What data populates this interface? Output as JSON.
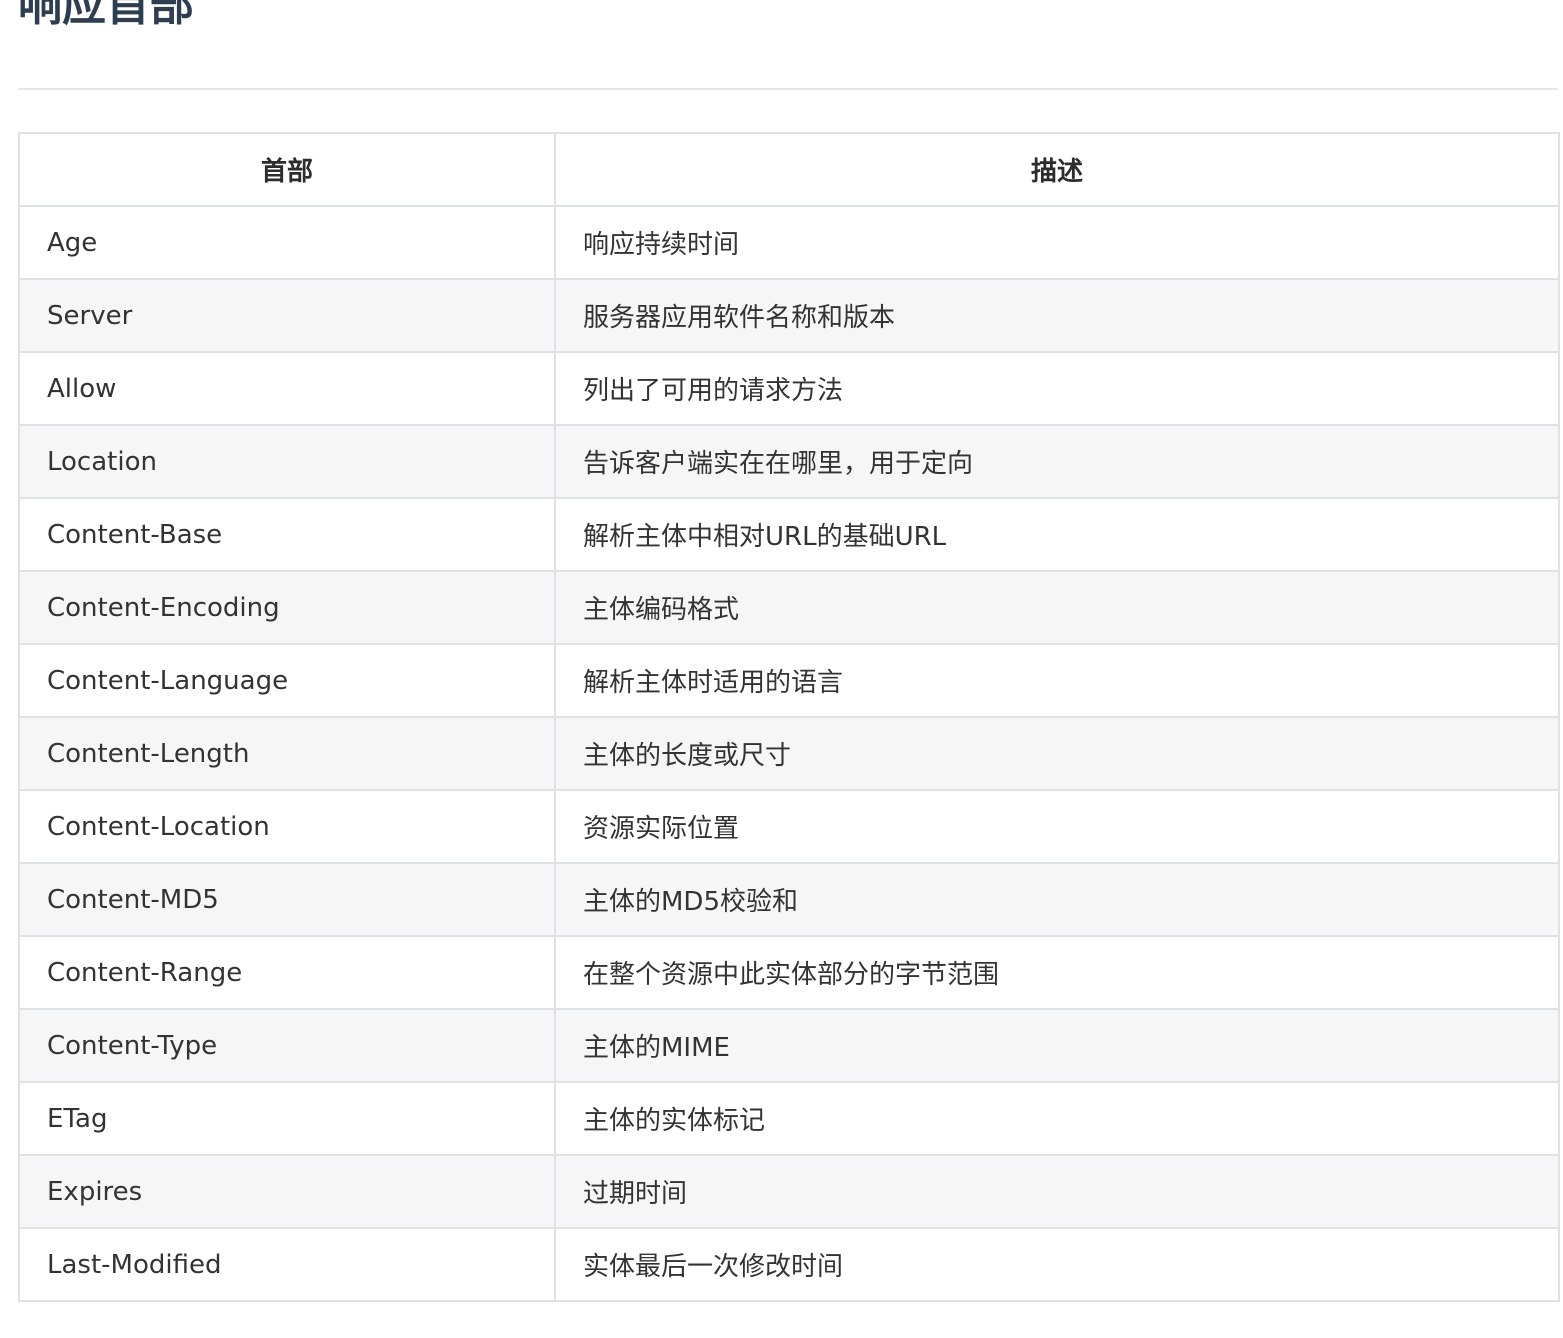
{
  "page": {
    "heading": "响应首部"
  },
  "table": {
    "columns": [
      "首部",
      "描述"
    ],
    "rows": [
      {
        "header": "Age",
        "description": "响应持续时间"
      },
      {
        "header": "Server",
        "description": "服务器应用软件名称和版本"
      },
      {
        "header": "Allow",
        "description": "列出了可用的请求方法"
      },
      {
        "header": "Location",
        "description": "告诉客户端实在在哪里，用于定向"
      },
      {
        "header": "Content-Base",
        "description": "解析主体中相对URL的基础URL"
      },
      {
        "header": "Content-Encoding",
        "description": "主体编码格式"
      },
      {
        "header": "Content-Language",
        "description": "解析主体时适用的语言"
      },
      {
        "header": "Content-Length",
        "description": "主体的长度或尺寸"
      },
      {
        "header": "Content-Location",
        "description": "资源实际位置"
      },
      {
        "header": "Content-MD5",
        "description": "主体的MD5校验和"
      },
      {
        "header": "Content-Range",
        "description": "在整个资源中此实体部分的字节范围"
      },
      {
        "header": "Content-Type",
        "description": "主体的MIME"
      },
      {
        "header": "ETag",
        "description": "主体的实体标记"
      },
      {
        "header": "Expires",
        "description": "过期时间"
      },
      {
        "header": "Last-Modified",
        "description": "实体最后一次修改时间"
      }
    ]
  }
}
